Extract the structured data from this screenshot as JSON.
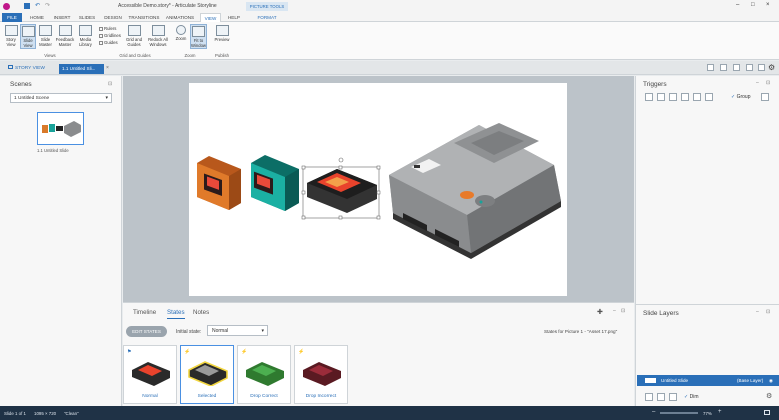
{
  "title": {
    "text": "Accessible Demo.story* - Articulate Storyline",
    "context_tab": "PICTURE TOOLS",
    "context_sub": "FORMAT"
  },
  "tabs": [
    "FILE",
    "HOME",
    "INSERT",
    "SLIDES",
    "DESIGN",
    "TRANSITIONS",
    "ANIMATIONS",
    "VIEW",
    "HELP"
  ],
  "ribbon": {
    "buttons": [
      {
        "label": "Story View"
      },
      {
        "label": "Slide View"
      },
      {
        "label": "Slide Master"
      },
      {
        "label": "Feedback Master"
      },
      {
        "label": "Media Library"
      }
    ],
    "checks": [
      "Rulers",
      "Gridlines",
      "Guides"
    ],
    "guides": [
      {
        "label": "Grid and Guides"
      },
      {
        "label": "Redock All Windows"
      }
    ],
    "zoom": [
      {
        "label": "Zoom"
      },
      {
        "label": "Fit to Window"
      }
    ],
    "preview": {
      "label": "Preview"
    },
    "groups": [
      "Views",
      "Grid and Guides",
      "Zoom",
      "Publish"
    ]
  },
  "docbar": {
    "story_tab": "STORY VIEW",
    "slide_tab": "1.1 Untitled Sli..."
  },
  "scenes": {
    "title": "Scenes",
    "dropdown": "1 Untitled Scene",
    "thumb_label": "1.1 Untitled Slide"
  },
  "bottom": {
    "tabs": [
      "Timeline",
      "States",
      "Notes"
    ],
    "edit_states": "EDIT STATES",
    "initial_state_label": "Initial state:",
    "initial_state_value": "Normal",
    "info": "States for Picture 1 - \"Asset 17.png\"",
    "states": [
      {
        "label": "Normal",
        "color": "#e8472b",
        "selected": false
      },
      {
        "label": "Selected",
        "color": "#e8472b",
        "selected": true
      },
      {
        "label": "Drop Correct",
        "color": "#3a8f3a",
        "selected": false
      },
      {
        "label": "Drop Incorrect",
        "color": "#8a2130",
        "selected": false
      }
    ]
  },
  "triggers": {
    "title": "Triggers",
    "group_label": "Group"
  },
  "layers": {
    "title": "Slide Layers",
    "base_name": "Untitled Slide",
    "base_tag": "(Base Layer)",
    "dim_label": "Dim"
  },
  "status": {
    "slide": "Slide 1 of 1",
    "size": "1095 × 720",
    "theme": "\"Clean\"",
    "zoom": "77%"
  },
  "colors": {
    "accent": "#2a6fb8",
    "status_bg": "#1f3246",
    "stage_bg": "#bcc3c9"
  }
}
